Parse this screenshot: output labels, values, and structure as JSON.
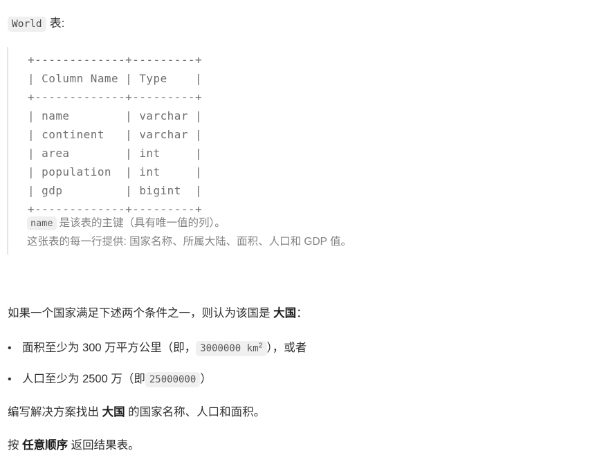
{
  "document": {
    "table_heading": {
      "code_label": "World",
      "suffix": "表:"
    },
    "schema_block": {
      "ascii_table": "+-------------+---------+\n| Column Name | Type    |\n+-------------+---------+\n| name        | varchar |\n| continent   | varchar |\n| area        | int     |\n| population  | int     |\n| gdp         | bigint  |\n+-------------+---------+",
      "columns": [
        {
          "name": "name",
          "type": "varchar"
        },
        {
          "name": "continent",
          "type": "varchar"
        },
        {
          "name": "area",
          "type": "int"
        },
        {
          "name": "population",
          "type": "int"
        },
        {
          "name": "gdp",
          "type": "bigint"
        }
      ],
      "header_row": {
        "name": "Column Name",
        "type": "Type"
      },
      "primary_key_note": {
        "code": "name",
        "text": "是该表的主键（具有唯一值的列）。"
      },
      "row_description": "这张表的每一行提供: 国家名称、所属大陆、面积、人口和 GDP 值。"
    },
    "condition_intro": {
      "prefix": "如果一个国家满足下述两个条件之一，则认为该国是 ",
      "bold": "大国",
      "suffix": "："
    },
    "conditions": [
      {
        "bullet": "•",
        "prefix": "面积至少为 300 万平方公里（即，",
        "code_value": "3000000",
        "code_unit": "km",
        "code_exponent": "2",
        "suffix": "），或者"
      },
      {
        "bullet": "•",
        "prefix": "人口至少为 2500 万（即",
        "code_value": "25000000",
        "suffix": "）"
      }
    ],
    "task_statement": {
      "prefix": "编写解决方案找出 ",
      "bold": "大国",
      "suffix": " 的国家名称、人口和面积。"
    },
    "order_statement": {
      "prefix": "按 ",
      "bold": "任意顺序",
      "suffix": " 返回结果表。"
    }
  },
  "colors": {
    "background": "#ffffff",
    "body_text": "#2f2f2f",
    "muted_text": "#838383",
    "code_bg": "#f0f0f0",
    "blockquote_border": "#e4e4e4",
    "ascii_text": "#6f6f6f"
  }
}
